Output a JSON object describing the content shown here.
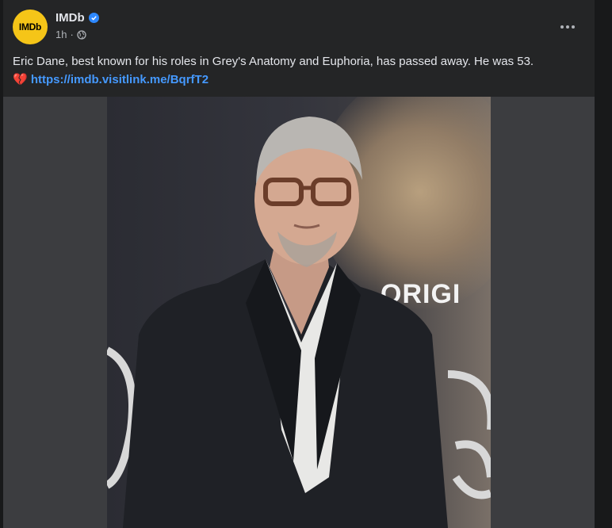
{
  "post": {
    "author": "IMDb",
    "avatar_text": "IMDb",
    "time": "1h",
    "separator": "·",
    "body_text": "Eric Dane, best known for his roles in Grey's Anatomy and Euphoria, has passed away. He was 53.",
    "emoji": "💔",
    "link_text": "https://imdb.visitlink.me/BqrfT2",
    "backdrop_text": "ORIGI"
  },
  "colors": {
    "background": "#18191a",
    "card": "#242526",
    "avatar": "#f5c518",
    "link": "#4599ff",
    "verified": "#2d88ff"
  },
  "icons": [
    "verified-badge-icon",
    "globe-icon",
    "more-options-icon",
    "broken-heart-icon"
  ]
}
